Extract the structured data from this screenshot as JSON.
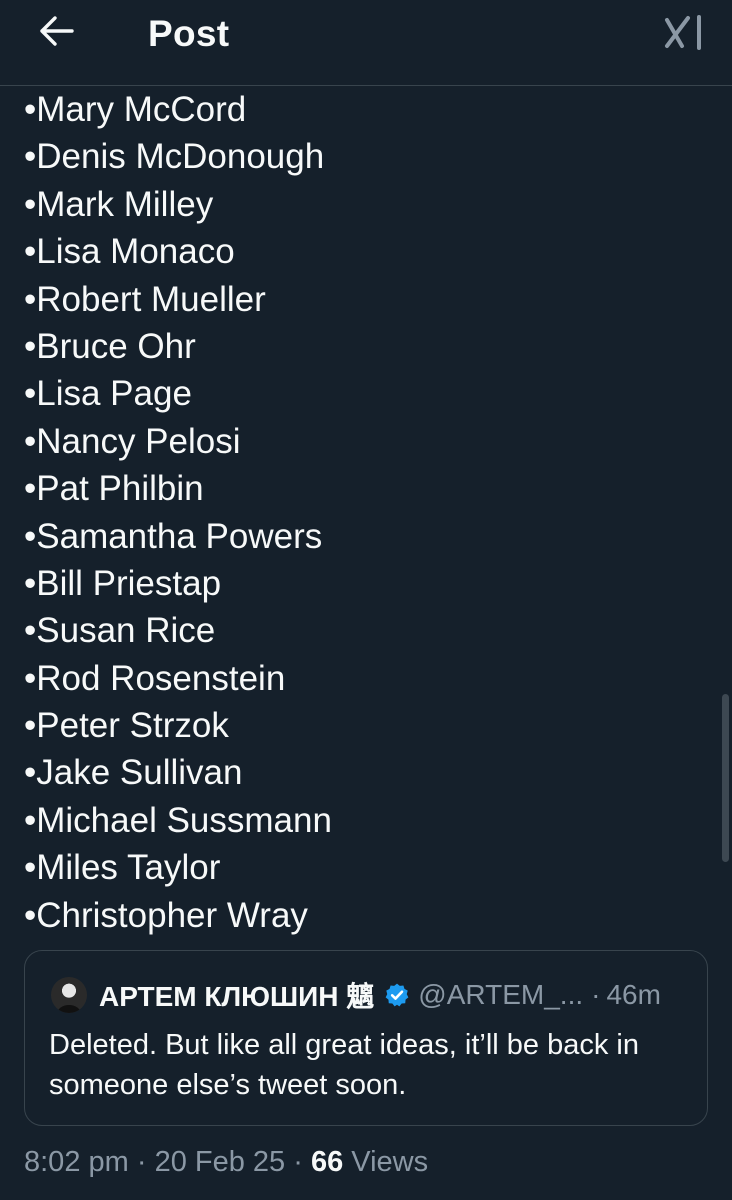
{
  "header": {
    "title": "Post",
    "back_icon": "arrow-left-icon",
    "grok_icon": "grok-icon"
  },
  "post": {
    "names": [
      "•Mary McCord",
      "•Denis McDonough",
      "•Mark Milley",
      "•Lisa Monaco",
      "•Robert Mueller",
      "•Bruce Ohr",
      "•Lisa Page",
      "•Nancy Pelosi",
      "•Pat Philbin",
      "•Samantha Powers",
      "•Bill Priestap",
      "•Susan Rice",
      "•Rod Rosenstein",
      "•Peter Strzok",
      "•Jake Sullivan",
      "•Michael Sussmann",
      "•Miles Taylor",
      "•Christopher Wray"
    ]
  },
  "quote": {
    "name": "АРТЕМ КЛЮШИН 魑",
    "handle": "@ARTEM_...",
    "separator": "·",
    "time": "46m",
    "text": "Deleted. But like all great ideas, it’ll be back in someone else’s tweet soon.",
    "verified_color": "#1d9bf0"
  },
  "meta": {
    "time": "8:02 pm",
    "sep1": " · ",
    "date": "20 Feb 25",
    "sep2": " · ",
    "views_count": "66",
    "views_label": " Views"
  },
  "colors": {
    "background": "#15202b",
    "text": "#f7f9f9",
    "secondary": "#8b98a5",
    "border": "#38444d"
  }
}
